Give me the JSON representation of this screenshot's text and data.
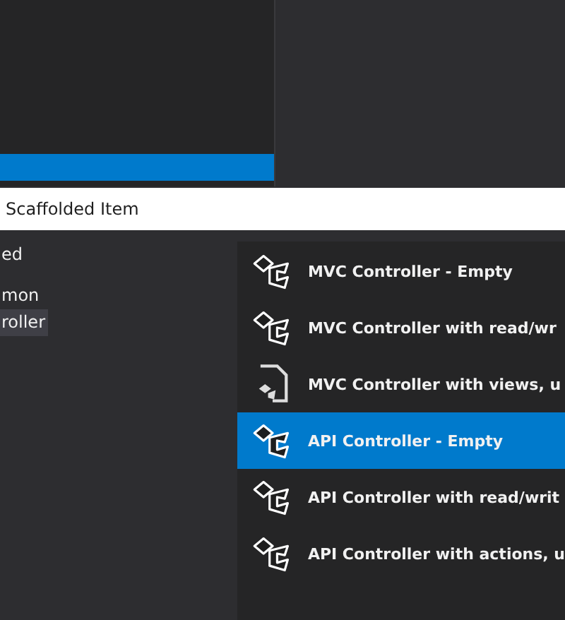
{
  "dialog": {
    "title": "Scaffolded Item"
  },
  "tree": [
    {
      "label": "ed",
      "selected": false,
      "children": [
        {
          "label": "mon",
          "selected": false,
          "children": [
            {
              "label": "roller",
              "selected": true
            }
          ]
        }
      ]
    }
  ],
  "templates": [
    {
      "kind": "controller",
      "label": "MVC Controller - Empty",
      "selected": false
    },
    {
      "kind": "controller",
      "label": "MVC Controller with read/wr",
      "selected": false
    },
    {
      "kind": "document",
      "label": "MVC Controller with views, u",
      "selected": false
    },
    {
      "kind": "controller",
      "label": "API Controller - Empty",
      "selected": true
    },
    {
      "kind": "controller",
      "label": "API Controller with read/writ",
      "selected": false
    },
    {
      "kind": "controller",
      "label": "API Controller with actions, u",
      "selected": false
    }
  ]
}
